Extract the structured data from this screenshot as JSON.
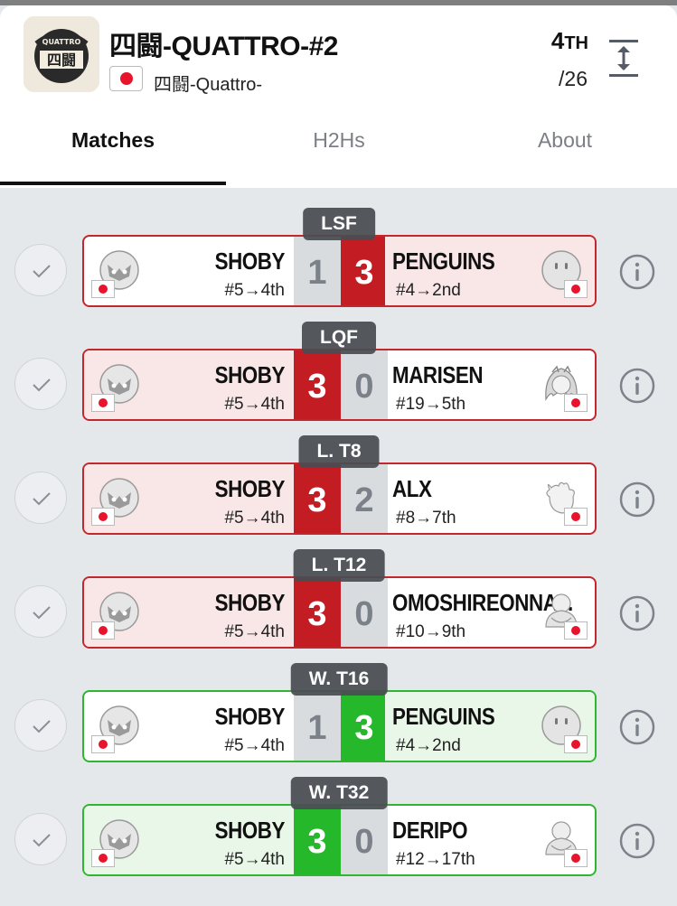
{
  "tournament": {
    "title": "四闘-QUATTRO-#2",
    "subtitle": "四闘-Quattro-",
    "logo_text": "QUATTRO 四闘",
    "rank_number": "4",
    "rank_suffix": "TH",
    "total": "/26"
  },
  "tabs": [
    {
      "label": "Matches",
      "active": true
    },
    {
      "label": "H2Hs",
      "active": false
    },
    {
      "label": "About",
      "active": false
    }
  ],
  "matches": [
    {
      "round": "LSF",
      "left_name": "SHOBY",
      "left_seed": "#5→4th",
      "left_score": "1",
      "right_score": "3",
      "right_name": "PENGUINS",
      "right_seed": "#4→2nd",
      "result": "loss",
      "right_avatar": "round-face"
    },
    {
      "round": "LQF",
      "left_name": "SHOBY",
      "left_seed": "#5→4th",
      "left_score": "3",
      "right_score": "0",
      "right_name": "MARISEN",
      "right_seed": "#19→5th",
      "result": "win-red",
      "right_avatar": "girl"
    },
    {
      "round": "L. T8",
      "left_name": "SHOBY",
      "left_seed": "#5→4th",
      "left_score": "3",
      "right_score": "2",
      "right_name": "ALX",
      "right_seed": "#8→7th",
      "result": "win-red",
      "right_avatar": "creature"
    },
    {
      "round": "L. T12",
      "left_name": "SHOBY",
      "left_seed": "#5→4th",
      "left_score": "3",
      "right_score": "0",
      "right_name": "OMOSHIREONNA...",
      "right_seed": "#10→9th",
      "result": "win-red",
      "right_avatar": "old-man"
    },
    {
      "round": "W. T16",
      "left_name": "SHOBY",
      "left_seed": "#5→4th",
      "left_score": "1",
      "right_score": "3",
      "right_name": "PENGUINS",
      "right_seed": "#4→2nd",
      "result": "loss-green",
      "right_avatar": "round-face"
    },
    {
      "round": "W. T32",
      "left_name": "SHOBY",
      "left_seed": "#5→4th",
      "left_score": "3",
      "right_score": "0",
      "right_name": "DERIPO",
      "right_seed": "#12→17th",
      "result": "win-green",
      "right_avatar": "old-man"
    }
  ],
  "colors": {
    "red": "#c31d23",
    "green": "#25b82b",
    "flag_red": "#e8142b"
  }
}
